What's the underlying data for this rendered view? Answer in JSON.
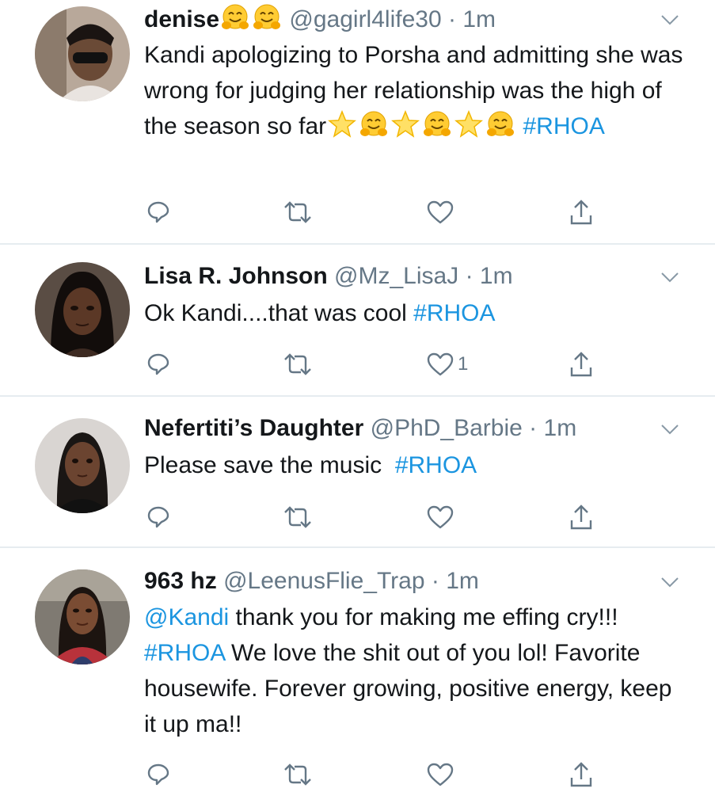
{
  "tweets": [
    {
      "name": "denise",
      "handle": "@gagirl4life30",
      "dot": "·",
      "time": "1m",
      "text_a": "Kandi apologizing to Porsha and admitting she was wrong for judging her relationship was the high of the season so far",
      "hashtag": "#RHOA",
      "like_count": ""
    },
    {
      "name": "Lisa R. Johnson",
      "handle": "@Mz_LisaJ",
      "dot": "·",
      "time": "1m",
      "text_a": "Ok Kandi....that was cool ",
      "hashtag": "#RHOA",
      "like_count": "1"
    },
    {
      "name": "Nefertiti’s Daughter",
      "handle": "@PhD_Barbie",
      "dot": "·",
      "time": "1m",
      "text_a": "Please save the music  ",
      "hashtag": "#RHOA",
      "like_count": ""
    },
    {
      "name": "963 hz",
      "handle": "@LeenusFlie_Trap",
      "dot": "·",
      "time": "1m",
      "mention": "@Kandi",
      "text_a": " thank you for making me effing cry!!! ",
      "hashtag": "#RHOA",
      "text_b": " We love the shit out of you lol! Favorite housewife. Forever growing, positive energy, keep it up ma!!",
      "like_count": ""
    }
  ],
  "icons": {
    "reply": "reply-icon",
    "retweet": "retweet-icon",
    "like": "heart-icon",
    "share": "share-icon",
    "caret": "chevron-down-icon",
    "emoji_hug": "hugging-face-emoji",
    "emoji_star": "star-emoji"
  },
  "colors": {
    "link": "#1b95e0",
    "secondary": "#657786",
    "divider": "#e6ecf0"
  }
}
